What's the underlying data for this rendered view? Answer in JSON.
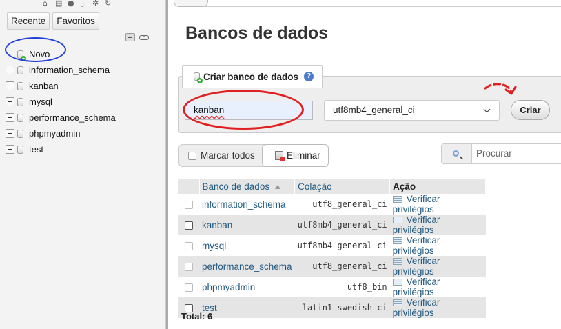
{
  "sidebar": {
    "tabs": [
      "Recente",
      "Favoritos"
    ],
    "tree": [
      {
        "label": "Novo",
        "kind": "new"
      },
      {
        "label": "information_schema",
        "kind": "db"
      },
      {
        "label": "kanban",
        "kind": "db"
      },
      {
        "label": "mysql",
        "kind": "db"
      },
      {
        "label": "performance_schema",
        "kind": "db"
      },
      {
        "label": "phpmyadmin",
        "kind": "db"
      },
      {
        "label": "test",
        "kind": "db"
      }
    ]
  },
  "main": {
    "title": "Bancos de dados",
    "create": {
      "legend": "Criar banco de dados",
      "name_value": "kanban",
      "collation_value": "utf8mb4_general_ci",
      "button_label": "Criar"
    },
    "bulk": {
      "check_all_label": "Marcar todos",
      "delete_label": "Eliminar"
    },
    "search": {
      "placeholder": "Procurar"
    },
    "table": {
      "headers": {
        "name": "Banco de dados",
        "collation": "Colação",
        "action": "Ação"
      },
      "rows": [
        {
          "name": "information_schema",
          "collation": "utf8_general_ci",
          "action": "Verificar privilégios",
          "checkbox_enabled": false
        },
        {
          "name": "kanban",
          "collation": "utf8mb4_general_ci",
          "action": "Verificar privilégios",
          "checkbox_enabled": true
        },
        {
          "name": "mysql",
          "collation": "utf8mb4_general_ci",
          "action": "Verificar privilégios",
          "checkbox_enabled": false
        },
        {
          "name": "performance_schema",
          "collation": "utf8_general_ci",
          "action": "Verificar privilégios",
          "checkbox_enabled": false
        },
        {
          "name": "phpmyadmin",
          "collation": "utf8_bin",
          "action": "Verificar privilégios",
          "checkbox_enabled": false
        },
        {
          "name": "test",
          "collation": "latin1_swedish_ci",
          "action": "Verificar privilégios",
          "checkbox_enabled": true
        }
      ],
      "total": "Total: 6"
    }
  },
  "colors": {
    "link": "#235a81",
    "annotation_red": "#e02020",
    "annotation_blue": "#1e3fd9",
    "autofill_bg": "#e8f0fe"
  },
  "icons": [
    "home-icon",
    "database-icon",
    "help-icon",
    "docs-icon",
    "settings-icon",
    "reload-icon",
    "collapse-all-icon",
    "link-icon",
    "search-icon",
    "delete-icon",
    "privileges-icon",
    "sort-asc-icon"
  ]
}
